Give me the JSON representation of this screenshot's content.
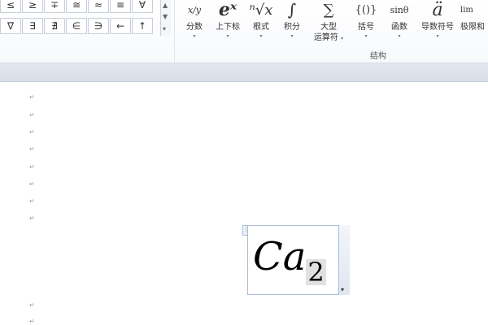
{
  "symbols": {
    "row1": [
      "≤",
      "≥",
      "∓",
      "≅",
      "≈",
      "≡",
      "∀"
    ],
    "row2": [
      "∇",
      "∃",
      "∄",
      "∈",
      "∋",
      "←",
      "↑"
    ],
    "scroll_up": "▲",
    "scroll_down": "▼",
    "more": "▾"
  },
  "structures": {
    "group_label": "结构",
    "items": [
      {
        "label": "分数",
        "icon_text": "x/y",
        "icon": "fraction-icon"
      },
      {
        "label": "上下标",
        "icon_text": "eˣ",
        "icon": "script-icon"
      },
      {
        "label": "根式",
        "icon_text": "ⁿ√x",
        "icon": "radical-icon"
      },
      {
        "label": "积分",
        "icon_text": "∫",
        "icon": "integral-icon"
      },
      {
        "label": "大型\n运算符",
        "label_line1": "大型",
        "label_line2": "运算符",
        "icon_text": "∑",
        "icon": "large-operator-icon"
      },
      {
        "label": "括号",
        "icon_text": "{()}",
        "icon": "bracket-icon"
      },
      {
        "label": "函数",
        "icon_text": "sinθ",
        "icon": "function-icon"
      },
      {
        "label": "导数符号",
        "icon_text": "ä",
        "icon": "accent-icon"
      },
      {
        "label": "极限和",
        "icon_text": "lim",
        "icon": "limit-icon"
      }
    ]
  },
  "document": {
    "paragraph_mark": "↵",
    "equation": {
      "base": "Ca",
      "subscript": "2",
      "handle": "⋮",
      "options_arrow": "▾"
    }
  }
}
